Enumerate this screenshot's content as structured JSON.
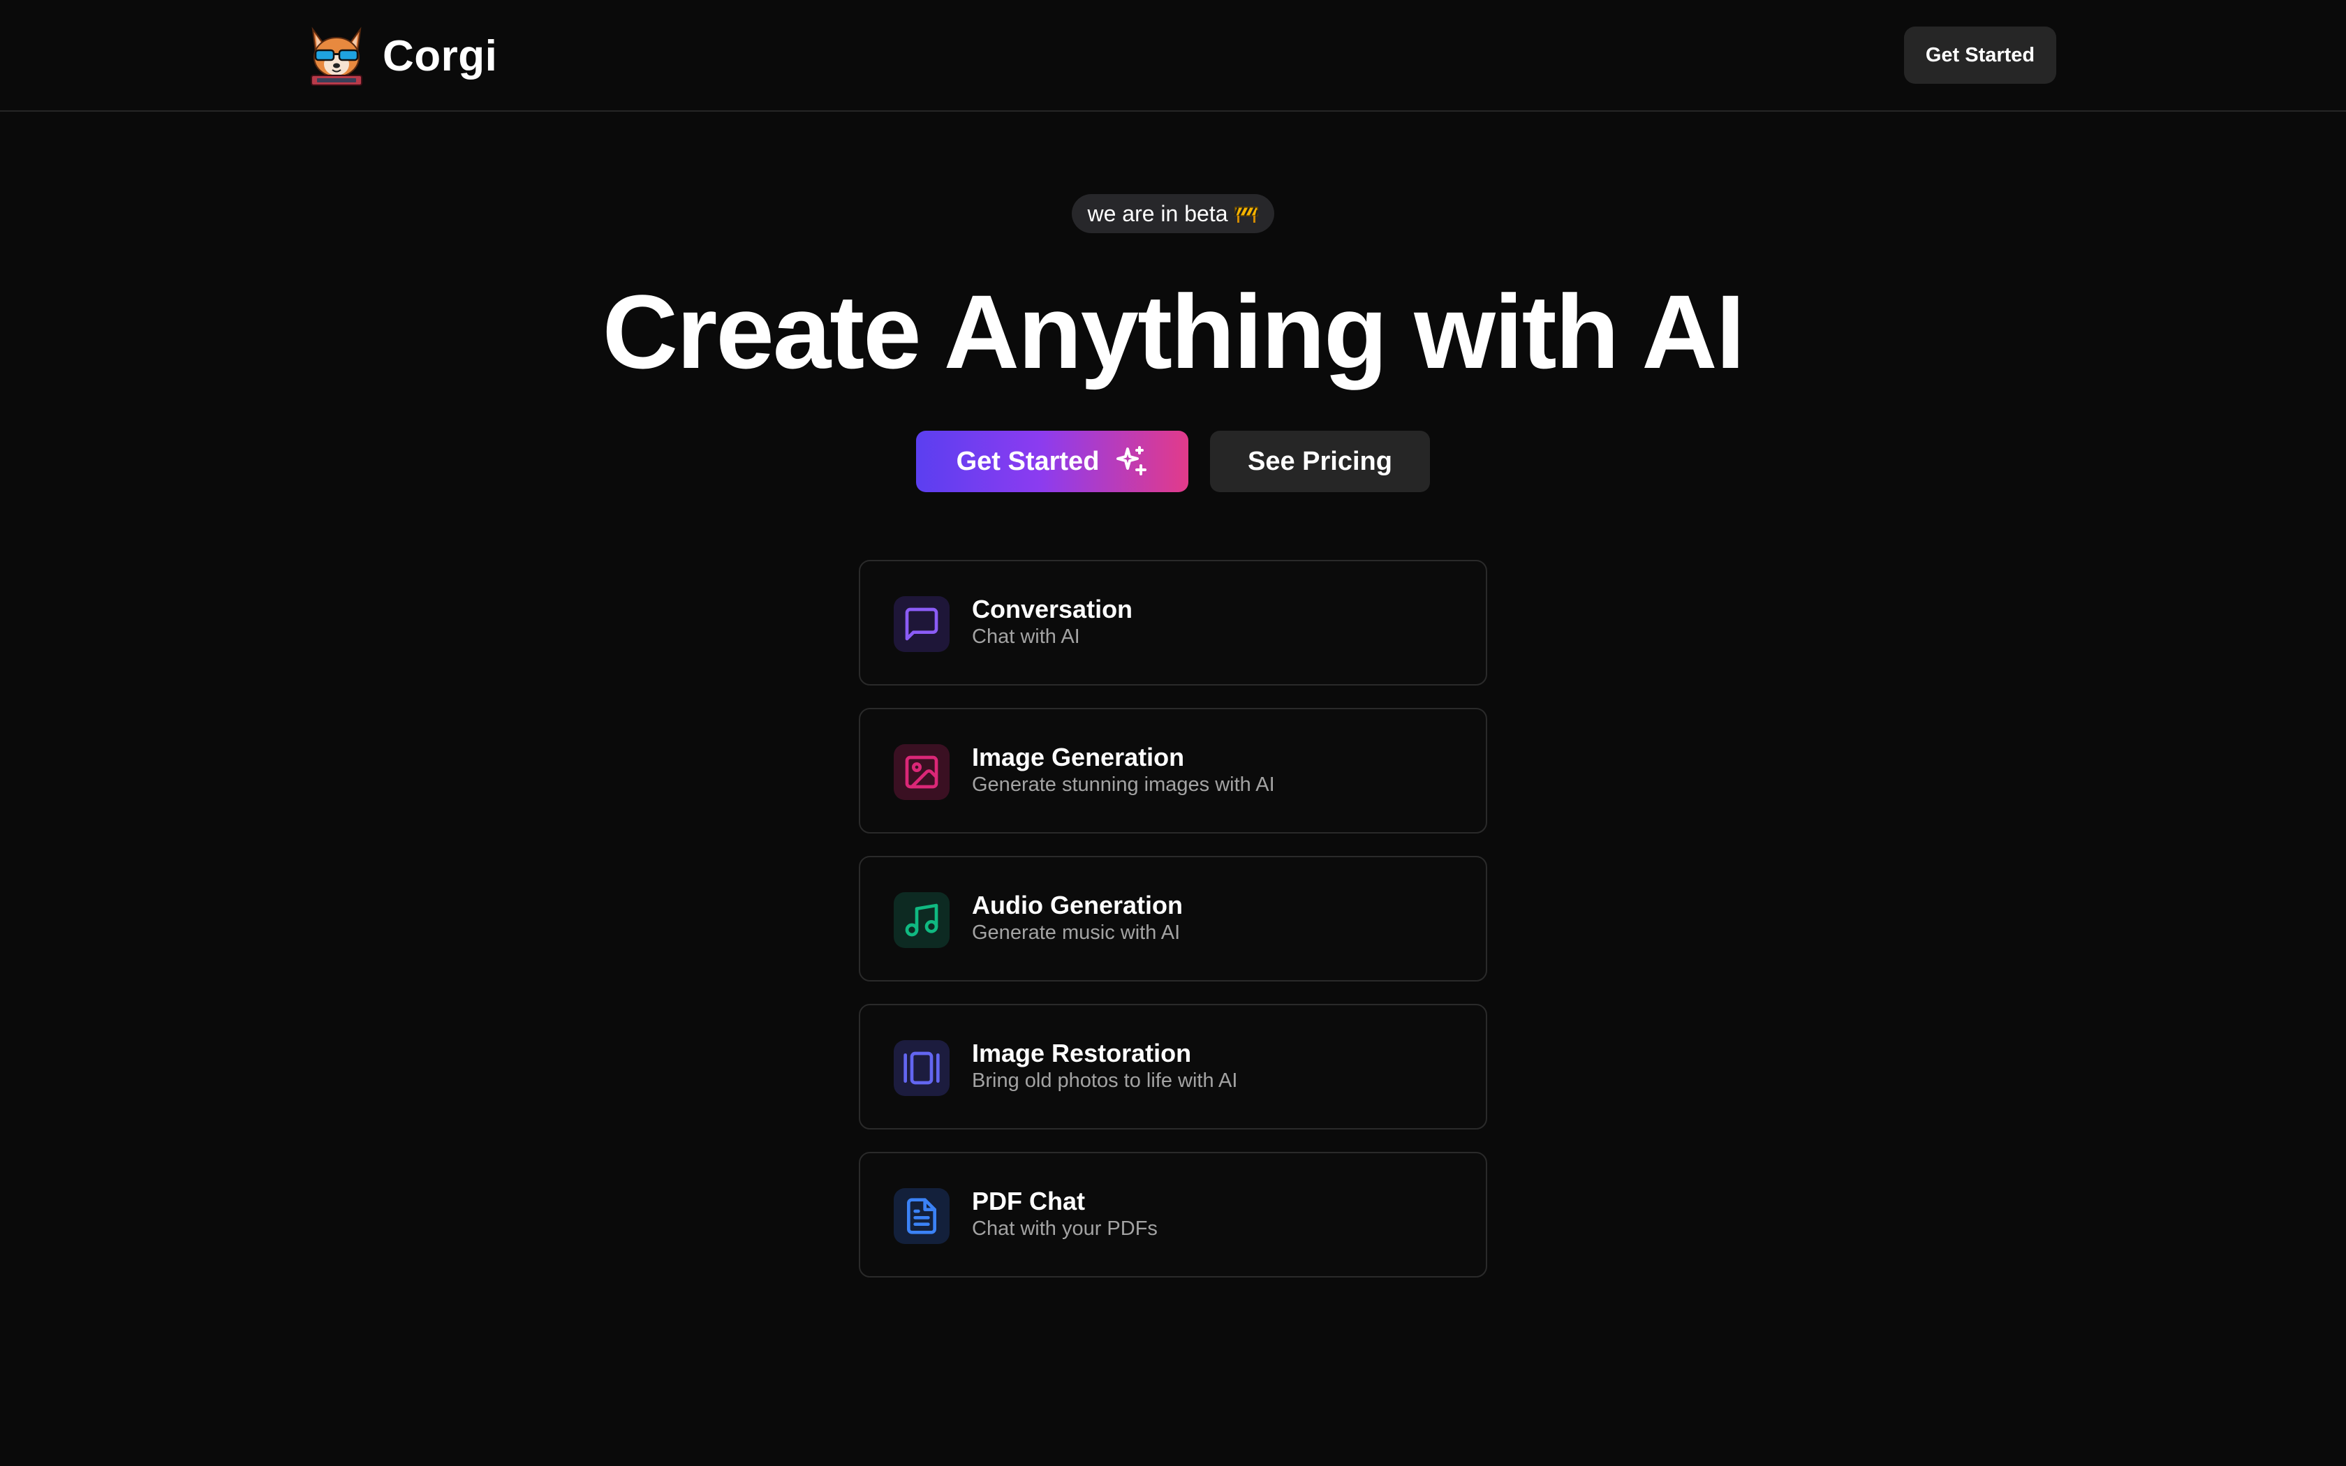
{
  "header": {
    "brand": "Corgi",
    "cta_label": "Get Started"
  },
  "hero": {
    "badge": "we are in beta",
    "title": "Create Anything with AI",
    "primary_cta": "Get Started",
    "secondary_cta": "See Pricing"
  },
  "features": [
    {
      "title": "Conversation",
      "description": "Chat with AI",
      "icon": "message-square-icon",
      "color": "#8b5cf6",
      "bg": "#1e1638"
    },
    {
      "title": "Image Generation",
      "description": "Generate stunning images with AI",
      "icon": "image-icon",
      "color": "#db2777",
      "bg": "#3a1022"
    },
    {
      "title": "Audio Generation",
      "description": "Generate music with AI",
      "icon": "music-icon",
      "color": "#10b981",
      "bg": "#0d2a22"
    },
    {
      "title": "Image Restoration",
      "description": "Bring old photos to life with AI",
      "icon": "gallery-icon",
      "color": "#6366f1",
      "bg": "#1c1c3e"
    },
    {
      "title": "PDF Chat",
      "description": "Chat with your PDFs",
      "icon": "file-text-icon",
      "color": "#3b82f6",
      "bg": "#13203b"
    }
  ]
}
